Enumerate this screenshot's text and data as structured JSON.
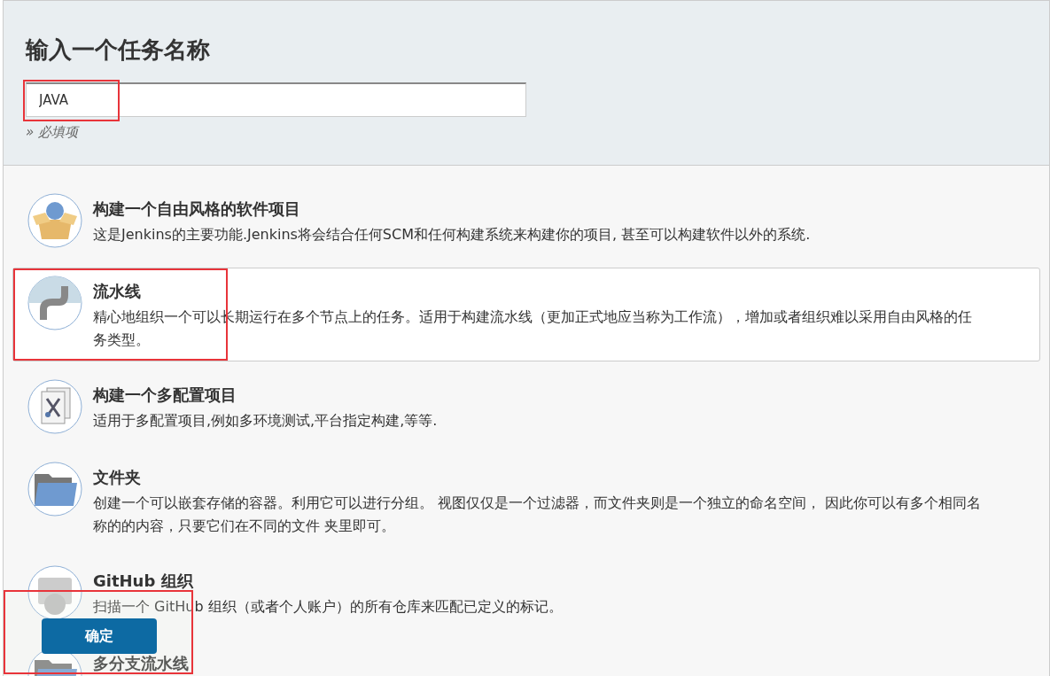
{
  "header": {
    "title": "输入一个任务名称",
    "name_field": {
      "value": "JAVA",
      "highlight": true
    },
    "hint": "» 必填项"
  },
  "items": [
    {
      "kind": "freestyle",
      "title": "构建一个自由风格的软件项目",
      "description": "这是Jenkins的主要功能.Jenkins将会结合任何SCM和任何构建系统来构建你的项目, 甚至可以构建软件以外的系统.",
      "selected": false,
      "highlight": false
    },
    {
      "kind": "pipeline",
      "title": "流水线",
      "description": "精心地组织一个可以长期运行在多个节点上的任务。适用于构建流水线（更加正式地应当称为工作流），增加或者组织难以采用自由风格的任务类型。",
      "selected": true,
      "highlight": true
    },
    {
      "kind": "multiconfig",
      "title": "构建一个多配置项目",
      "description": "适用于多配置项目,例如多环境测试,平台指定构建,等等.",
      "selected": false,
      "highlight": false
    },
    {
      "kind": "folder",
      "title": "文件夹",
      "description": "创建一个可以嵌套存储的容器。利用它可以进行分组。 视图仅仅是一个过滤器，而文件夹则是一个独立的命名空间， 因此你可以有多个相同名称的的内容，只要它们在不同的文件 夹里即可。",
      "selected": false,
      "highlight": false
    },
    {
      "kind": "github",
      "title": "GitHub 组织",
      "description": "扫描一个 GitHub 组织（或者个人账户）的所有仓库来匹配已定义的标记。",
      "selected": false,
      "highlight": false
    },
    {
      "kind": "multibranch",
      "title": "多分支流水线",
      "selected": false,
      "highlight": false
    }
  ],
  "footer": {
    "ok_button": "确定",
    "highlight": true
  }
}
